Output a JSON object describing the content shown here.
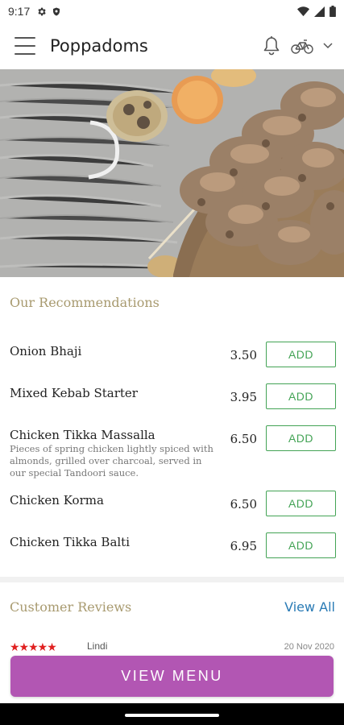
{
  "status_bar": {
    "time": "9:17",
    "left_icons": [
      "gear-icon",
      "shield-icon"
    ],
    "right_icons": [
      "wifi-icon",
      "signal-icon",
      "battery-icon"
    ]
  },
  "app_bar": {
    "title": "Poppadoms",
    "icons": [
      "menu-icon",
      "bell-icon",
      "bicycle-icon",
      "chevron-down-icon"
    ]
  },
  "recommendations": {
    "title": "Our Recommendations",
    "add_label": "ADD",
    "items": [
      {
        "name": "Onion Bhaji",
        "description": "",
        "price": "3.50"
      },
      {
        "name": "Mixed Kebab Starter",
        "description": "",
        "price": "3.95"
      },
      {
        "name": "Chicken Tikka Massalla",
        "description": "Pieces of spring chicken lightly spiced with almonds, grilled over charcoal, served in our special Tandoori sauce.",
        "price": "6.50"
      },
      {
        "name": "Chicken Korma",
        "description": "",
        "price": "6.50"
      },
      {
        "name": "Chicken Tikka Balti",
        "description": "",
        "price": "6.95"
      }
    ]
  },
  "reviews": {
    "title": "Customer Reviews",
    "view_all_label": "View All",
    "first_review": {
      "stars": "★★★★★",
      "rating": 5,
      "reviewer": "Lindi",
      "date": "20 Nov 2020"
    }
  },
  "footer": {
    "view_menu_label": "VIEW MENU"
  },
  "colors": {
    "accent_gold": "#a89a6f",
    "add_green": "#43a355",
    "view_menu_purple": "#b256b3",
    "link_blue": "#2a7bb5",
    "star_red": "#e02020"
  }
}
